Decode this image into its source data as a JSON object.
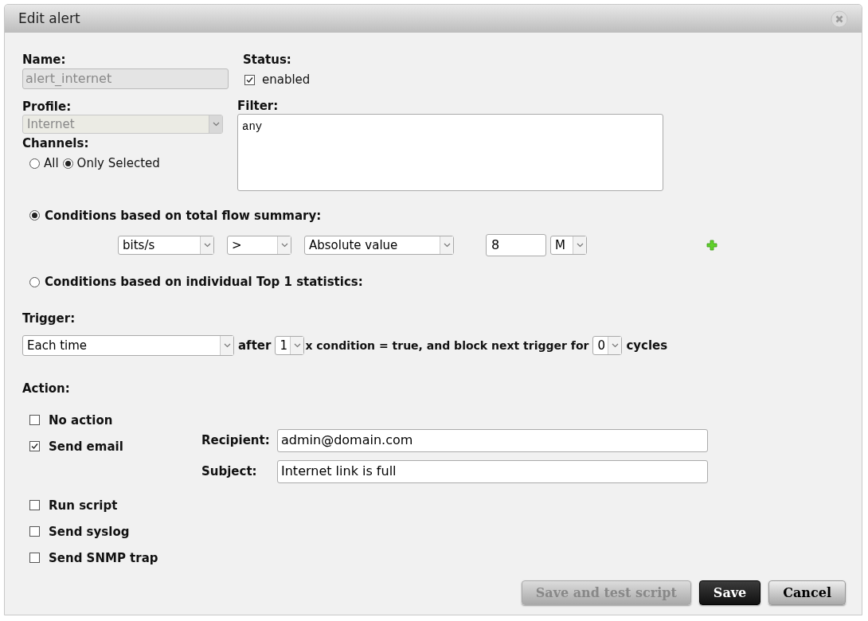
{
  "window": {
    "title": "Edit alert"
  },
  "name": {
    "label": "Name:",
    "value": "alert_internet",
    "disabled": true
  },
  "status": {
    "label": "Status:",
    "option": "enabled",
    "checked": true
  },
  "profile": {
    "label": "Profile:",
    "value": "Internet",
    "disabled": true
  },
  "channels": {
    "label": "Channels:",
    "options": [
      {
        "label": "All",
        "selected": false
      },
      {
        "label": "Only Selected",
        "selected": true
      }
    ]
  },
  "filter": {
    "label": "Filter:",
    "value": "any"
  },
  "condition_modes": [
    {
      "label": "Conditions based on total flow summary:",
      "selected": true
    },
    {
      "label": "Conditions based on individual Top 1 statistics:",
      "selected": false
    }
  ],
  "conditions": [
    {
      "metric": "bits/s",
      "operator": ">",
      "mode": "Absolute value",
      "value": "8",
      "unit": "M"
    }
  ],
  "trigger": {
    "label": "Trigger:",
    "mode": "Each time",
    "after": "after",
    "count": "1",
    "middle": "x condition = true, and block next trigger for",
    "block": "0",
    "end": "cycles"
  },
  "action": {
    "label": "Action:",
    "items": [
      {
        "label": "No action",
        "checked": false
      },
      {
        "label": "Send email",
        "checked": true,
        "fields": [
          {
            "label": "Recipient:",
            "value": "admin@domain.com"
          },
          {
            "label": "Subject:",
            "value": "Internet link is full"
          }
        ]
      },
      {
        "label": "Run script",
        "checked": false
      },
      {
        "label": "Send syslog",
        "checked": false
      },
      {
        "label": "Send SNMP trap",
        "checked": false
      }
    ]
  },
  "buttons": [
    {
      "label": "Save and test script",
      "kind": "secondary",
      "disabled": true
    },
    {
      "label": "Save",
      "kind": "primary",
      "disabled": false
    },
    {
      "label": "Cancel",
      "kind": "secondary",
      "disabled": false
    }
  ]
}
